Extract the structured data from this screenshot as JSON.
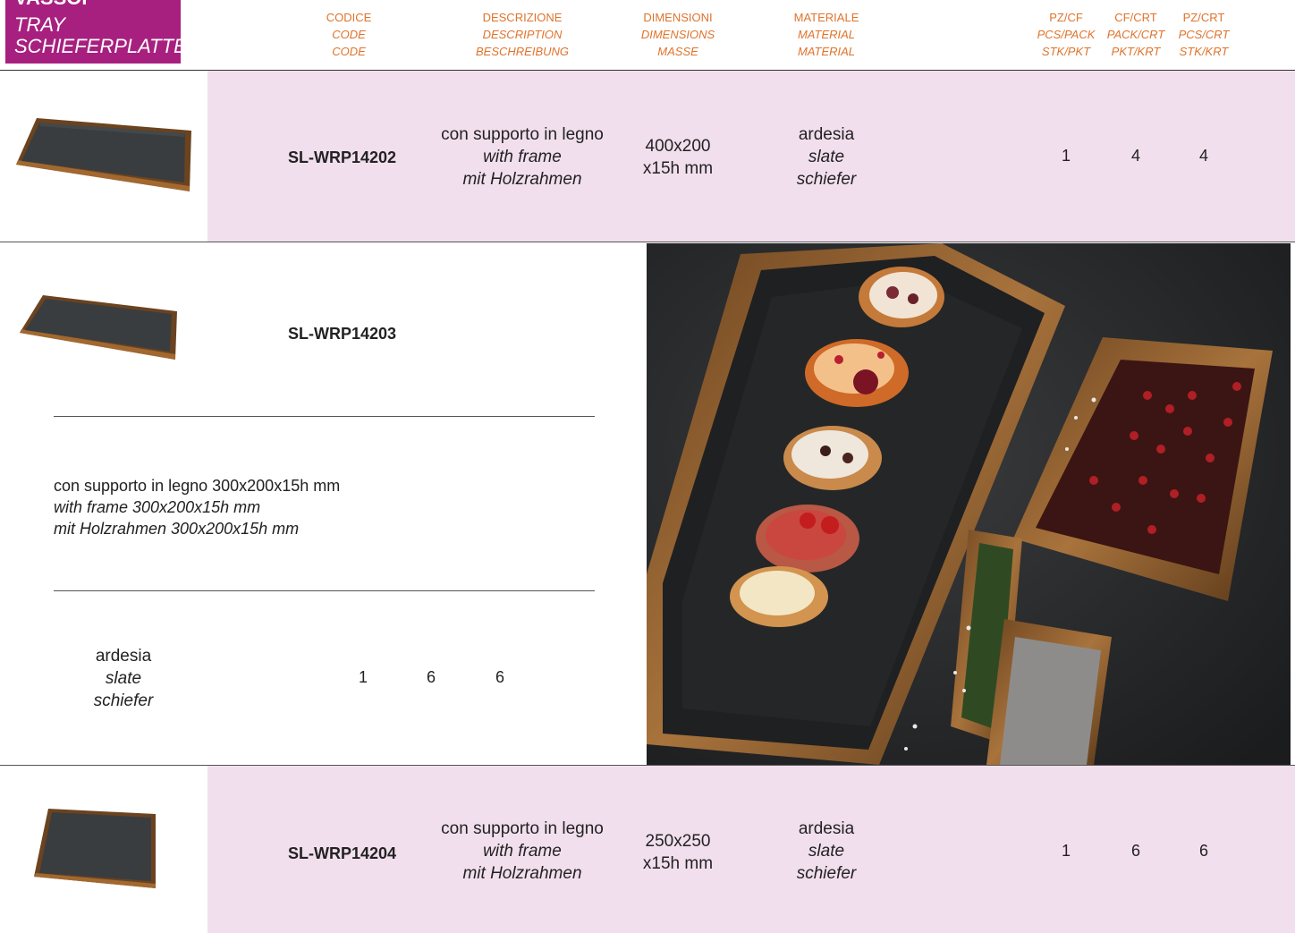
{
  "category": {
    "line1": "VASSOI",
    "line2": "TRAY",
    "line3": "SCHIEFERPLATTEN",
    "color": "#a7207f"
  },
  "headers": {
    "codice": [
      "CODICE",
      "CODE",
      "CODE"
    ],
    "descrizione": [
      "DESCRIZIONE",
      "DESCRIPTION",
      "BESCHREIBUNG"
    ],
    "dimensioni": [
      "DIMENSIONI",
      "DIMENSIONS",
      "MASSE"
    ],
    "materiale": [
      "MATERIALE",
      "MATERIAL",
      "MATERIAL"
    ],
    "pzcf": [
      "PZ/CF",
      "PCS/PACK",
      "STK/PKT"
    ],
    "cfcrt": [
      "CF/CRT",
      "PACK/CRT",
      "PKT/KRT"
    ],
    "pzcrt": [
      "PZ/CRT",
      "PCS/CRT",
      "STK/KRT"
    ],
    "accent": "#e0732c"
  },
  "products": [
    {
      "code": "SL-WRP14202",
      "desc_it": "con supporto in legno",
      "desc_en": "with frame",
      "desc_de": "mit Holzrahmen",
      "dim1": "400x200",
      "dim2": "x15h mm",
      "mat_it": "ardesia",
      "mat_en": "slate",
      "mat_de": "schiefer",
      "pzcf": "1",
      "cfcrt": "4",
      "pzcrt": "4"
    },
    {
      "code": "SL-WRP14203",
      "desc_it": "con supporto in legno 300x200x15h mm",
      "desc_en": "with frame 300x200x15h mm",
      "desc_de": "mit Holzrahmen 300x200x15h mm",
      "mat_it": "ardesia",
      "mat_en": "slate",
      "mat_de": "schiefer",
      "pzcf": "1",
      "cfcrt": "6",
      "pzcrt": "6"
    },
    {
      "code": "SL-WRP14204",
      "desc_it": "con supporto in legno",
      "desc_en": "with frame",
      "desc_de": "mit Holzrahmen",
      "dim1": "250x250",
      "dim2": "x15h mm",
      "mat_it": "ardesia",
      "mat_en": "slate",
      "mat_de": "schiefer",
      "pzcf": "1",
      "cfcrt": "6",
      "pzcrt": "6"
    }
  ],
  "colors": {
    "pink_row": "#f2dfee",
    "slate": "#3a3d40",
    "wood": "#8a5a2b"
  }
}
